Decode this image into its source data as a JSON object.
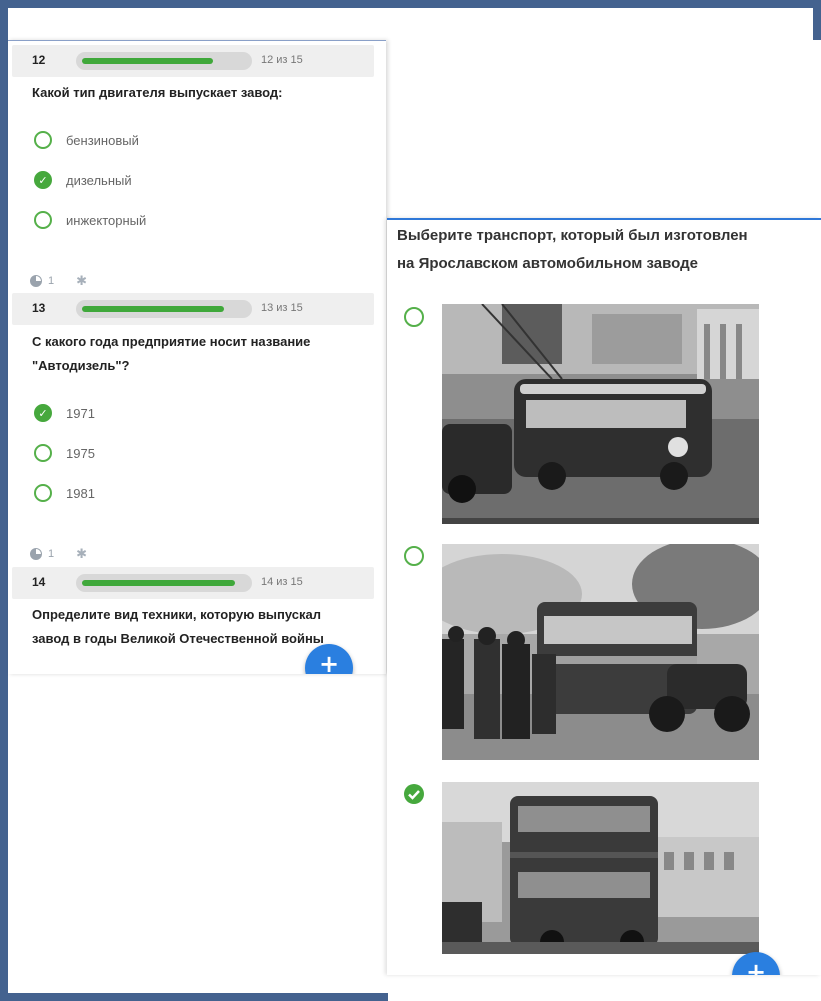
{
  "questions": [
    {
      "number": "12",
      "count": "12 из 15",
      "progress": 0.8,
      "text": "Какой тип двигателя выпускает завод:",
      "options": [
        {
          "label": "бензиновый",
          "checked": false
        },
        {
          "label": "дизельный",
          "checked": true
        },
        {
          "label": "инжекторный",
          "checked": false
        }
      ],
      "meta_count": "1"
    },
    {
      "number": "13",
      "count": "13 из 15",
      "progress": 0.867,
      "text_line1": "С какого года предприятие носит название",
      "text_line2": "\"Автодизель\"?",
      "options": [
        {
          "label": "1971",
          "checked": true
        },
        {
          "label": "1975",
          "checked": false
        },
        {
          "label": "1981",
          "checked": false
        }
      ],
      "meta_count": "1"
    },
    {
      "number": "14",
      "count": "14 из 15",
      "progress": 0.933,
      "text_line1": "Определите вид техники, которую выпускал",
      "text_line2": "завод в годы Великой Отечественной войны"
    }
  ],
  "right_question": {
    "text_line1": "Выберите транспорт, который был изготовлен",
    "text_line2": "на Ярославском автомобильном заводе",
    "options": [
      {
        "image": "trolleybus-photo",
        "checked": false
      },
      {
        "image": "bus-photo",
        "checked": false
      },
      {
        "image": "double-decker-trolleybus-photo",
        "checked": true
      }
    ]
  },
  "icons": {
    "check": "✓",
    "plus": "+",
    "star": "✱"
  },
  "colors": {
    "accent_green": "#46a83d",
    "progress_green": "#3fa83a",
    "fab_blue": "#2a7fe0",
    "frame_blue": "#44628f"
  }
}
